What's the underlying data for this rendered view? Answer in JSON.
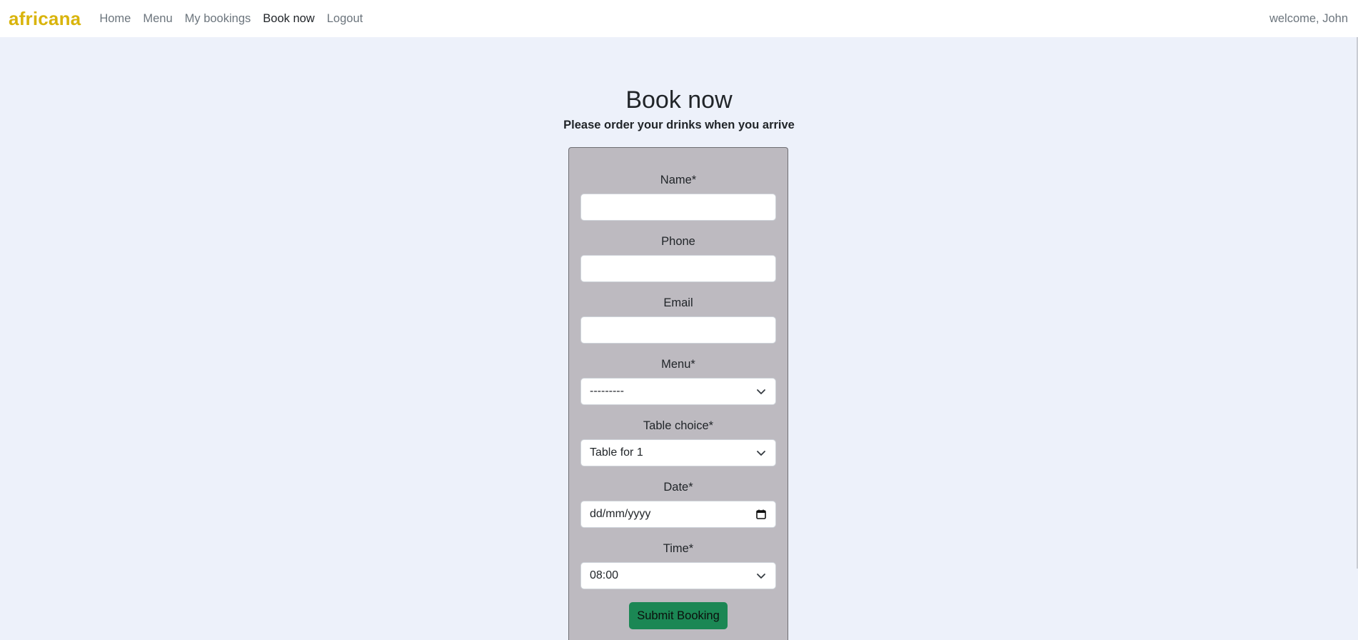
{
  "navbar": {
    "brand": "africana",
    "links": [
      "Home",
      "Menu",
      "My bookings",
      "Book now",
      "Logout"
    ],
    "active": "Book now",
    "welcome": "welcome, John"
  },
  "page": {
    "title": "Book now",
    "subtitle": "Please order your drinks when you arrive"
  },
  "form": {
    "fields": {
      "name": {
        "label": "Name*",
        "value": ""
      },
      "phone": {
        "label": "Phone",
        "value": ""
      },
      "email": {
        "label": "Email",
        "value": ""
      },
      "menu": {
        "label": "Menu*",
        "value": "---------"
      },
      "table": {
        "label": "Table choice*",
        "value": "Table for 1"
      },
      "date": {
        "label": "Date*",
        "value": "dd/mm/yyyy"
      },
      "time": {
        "label": "Time*",
        "value": "08:00"
      }
    },
    "submit_label": "Submit Booking"
  },
  "colors": {
    "brand": "#d9b40c",
    "background": "#edf1fa",
    "form_card": "#bdbac0",
    "submit": "#1b8754"
  },
  "icons": {
    "select": "chevron-down-icon",
    "date": "calendar-icon"
  }
}
